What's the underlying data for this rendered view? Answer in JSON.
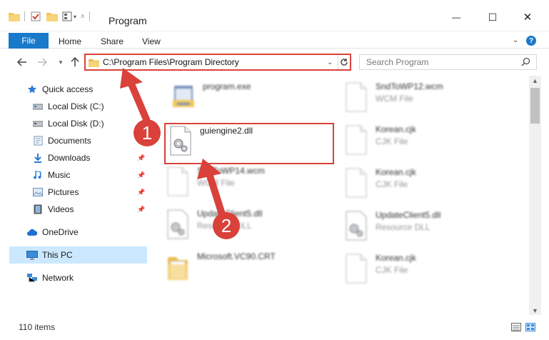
{
  "window": {
    "title": "Program",
    "minimize_label": "—",
    "maximize_label": "☐",
    "close_label": "✕"
  },
  "ribbon": {
    "tabs": [
      "File",
      "Home",
      "Share",
      "View"
    ],
    "help_label": "?"
  },
  "nav": {
    "address": "C:\\Program Files\\Program Directory",
    "search_placeholder": "Search Program"
  },
  "sidebar": {
    "items": [
      {
        "label": "Quick access",
        "icon": "star-icon"
      },
      {
        "label": "Local Disk (C:)",
        "icon": "drive-icon"
      },
      {
        "label": "Local Disk (D:)",
        "icon": "drive-icon"
      },
      {
        "label": "Documents",
        "icon": "documents-icon"
      },
      {
        "label": "Downloads",
        "icon": "download-icon"
      },
      {
        "label": "Music",
        "icon": "music-icon"
      },
      {
        "label": "Pictures",
        "icon": "pictures-icon"
      },
      {
        "label": "Videos",
        "icon": "videos-icon"
      },
      {
        "label": "OneDrive",
        "icon": "cloud-icon"
      },
      {
        "label": "This PC",
        "icon": "computer-icon"
      },
      {
        "label": "Network",
        "icon": "network-icon"
      }
    ]
  },
  "files": [
    {
      "name": "program.exe",
      "type": ""
    },
    {
      "name": "guiengine2.dll",
      "type": ""
    },
    {
      "name": "SndToWP14.wcm",
      "type": "WCM File"
    },
    {
      "name": "UpdateClient5.dll",
      "type": "Resource DLL"
    },
    {
      "name": "Microsoft.VC90.CRT",
      "type": ""
    },
    {
      "name": "SndToWP12.wcm",
      "type": "WCM File"
    },
    {
      "name": "Korean.cjk",
      "type": "CJK File"
    },
    {
      "name": "Korean.cjk",
      "type": "CJK File"
    },
    {
      "name": "UpdateClient5.dll",
      "type": "Resource DLL"
    },
    {
      "name": "Korean.cjk",
      "type": "CJK File"
    }
  ],
  "status": {
    "item_count": "110 items"
  },
  "annotations": {
    "step1": "1",
    "step2": "2",
    "color": "#d9413a"
  }
}
